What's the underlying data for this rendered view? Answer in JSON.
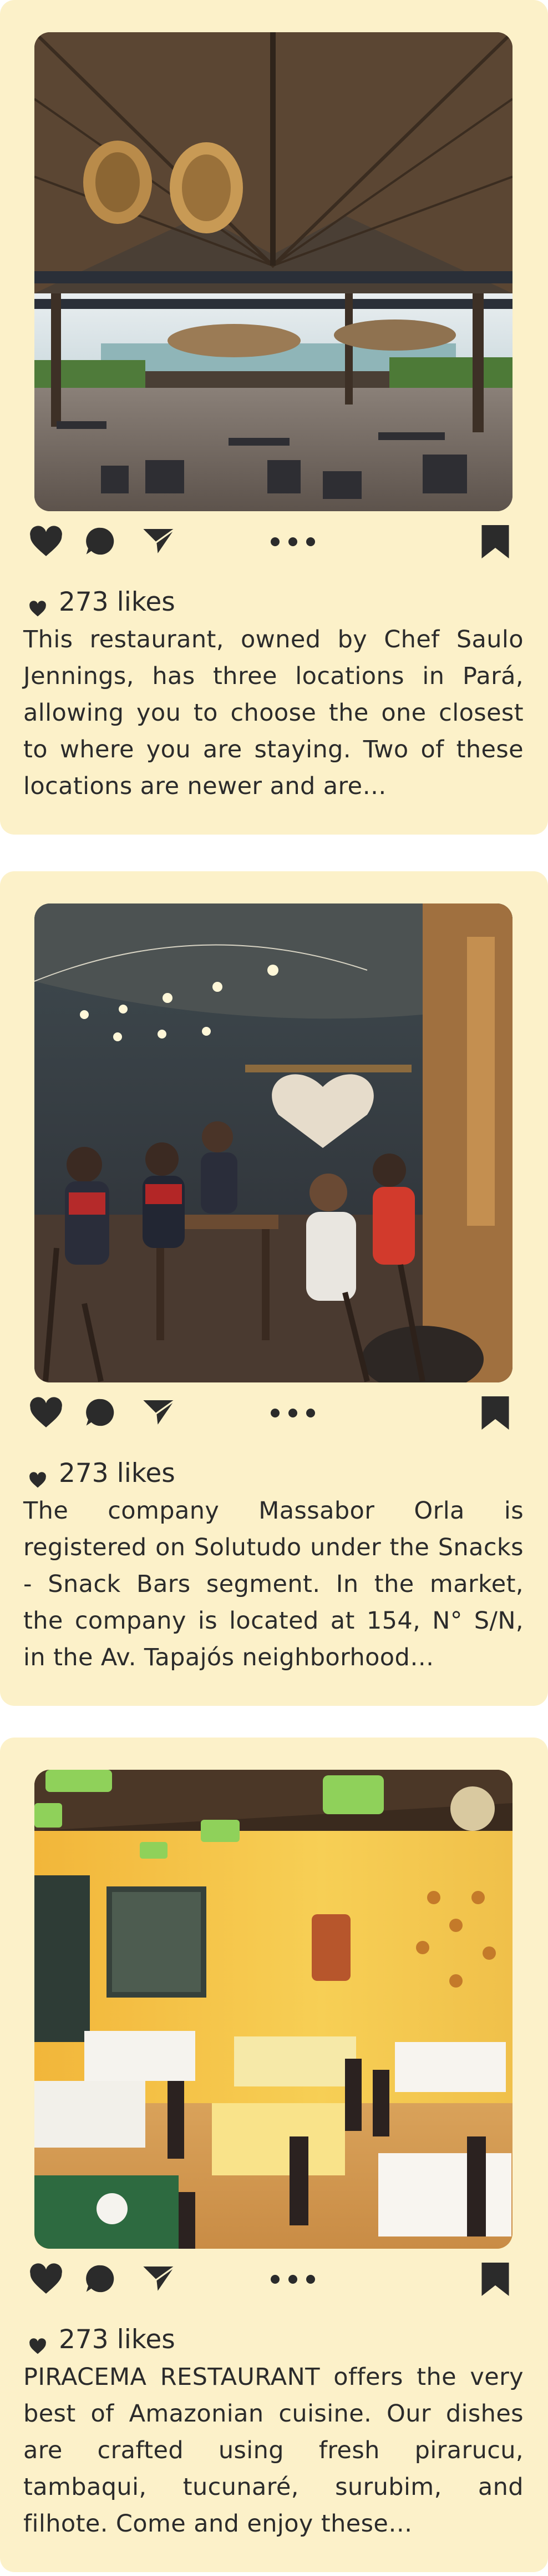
{
  "feed": {
    "posts": [
      {
        "photo_alt": "restaurant-interior-thatched-roof",
        "likes_count": "273",
        "likes_label": "likes",
        "caption": "This restaurant, owned by Chef Saulo Jennings, has three locations in Pará, allowing you to choose the one closest to where you are staying. Two of these locations are newer and are…"
      },
      {
        "photo_alt": "restaurant-evening-guests",
        "likes_count": "273",
        "likes_label": "likes",
        "caption": "The company Massabor Orla is registered on Solutudo under the Snacks - Snack Bars segment. In the market, the company is located at 154, N° S/N, in the Av. Tapajós neighborhood…"
      },
      {
        "photo_alt": "restaurant-yellow-dining-room",
        "likes_count": "273",
        "likes_label": "likes",
        "caption": "PIRACEMA RESTAURANT offers the very best of Amazonian cuisine. Our dishes are crafted using fresh pirarucu, tambaqui, tucunaré, surubim, and filhote. Come and enjoy these…"
      }
    ]
  },
  "icons": {
    "like": "heart-icon",
    "comment": "comment-bubble-icon",
    "share": "send-arrow-icon",
    "more": "more-dots-icon",
    "save": "bookmark-icon"
  },
  "colors": {
    "card_background": "#fcf1c9",
    "icon_color": "#2b2b2b",
    "text_color": "#2b2b2b"
  }
}
